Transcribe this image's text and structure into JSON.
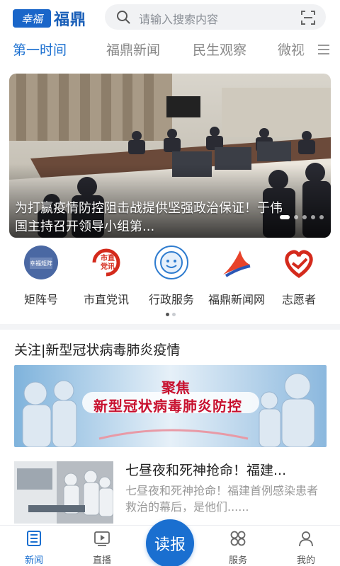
{
  "header": {
    "logo_badge": "幸福",
    "logo_text": "福鼎",
    "search_placeholder": "请输入搜索内容",
    "icons": [
      "search-icon",
      "scan-icon"
    ]
  },
  "tabs": [
    {
      "label": "第一时间",
      "active": true
    },
    {
      "label": "福鼎新闻",
      "active": false
    },
    {
      "label": "民生观察",
      "active": false
    },
    {
      "label": "微视",
      "active": false
    }
  ],
  "banner": {
    "caption": "为打赢疫情防控阻击战提供坚强政治保证！于伟国主持召开领导小组第...",
    "slide_count": 5,
    "active_slide": 1
  },
  "quick_entries": [
    {
      "label": "矩阵号",
      "icon": "matrix-icon"
    },
    {
      "label": "市直党讯",
      "icon": "party-news-icon"
    },
    {
      "label": "行政服务",
      "icon": "admin-service-icon"
    },
    {
      "label": "福鼎新闻网",
      "icon": "news-site-icon"
    },
    {
      "label": "志愿者",
      "icon": "volunteer-heart-icon"
    }
  ],
  "quick_pages": {
    "count": 2,
    "active": 1
  },
  "section": {
    "title": "关注|新型冠状病毒肺炎疫情",
    "promo_line1": "聚焦",
    "promo_line2": "新型冠状病毒肺炎防控"
  },
  "news": {
    "title": "七昼夜和死神抢命！福建...",
    "desc": "七昼夜和死神抢命！福建首例感染患者救治的幕后，是他们......"
  },
  "bottom_nav": [
    {
      "label": "新闻",
      "icon": "newspaper-icon",
      "active": true
    },
    {
      "label": "直播",
      "icon": "play-icon",
      "active": false
    },
    {
      "label": "读报",
      "icon": "read-paper",
      "active": false
    },
    {
      "label": "服务",
      "icon": "grid-icon",
      "active": false
    },
    {
      "label": "我的",
      "icon": "user-icon",
      "active": false
    }
  ],
  "colors": {
    "accent": "#1a6fd0",
    "promo_red": "#c8102e"
  }
}
